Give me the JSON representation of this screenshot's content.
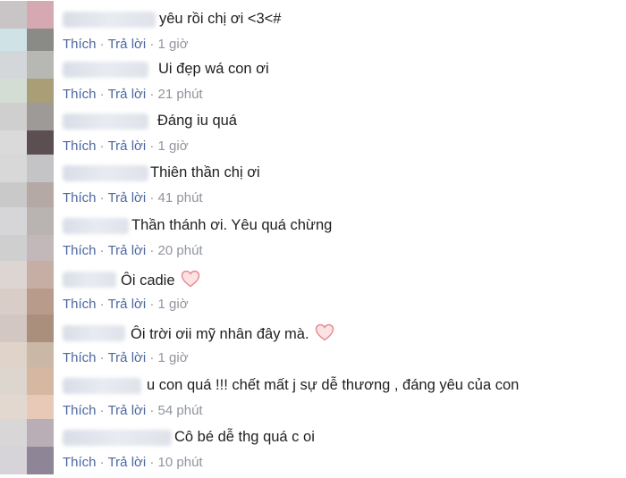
{
  "labels": {
    "like": "Thích",
    "reply": "Trả lời",
    "separator": " · "
  },
  "colors": {
    "link": "#4b67a1",
    "meta": "#90949c",
    "text": "#1c1e21",
    "heart": "#e8888e"
  },
  "comments": [
    {
      "text": "yêu rồi chị ơi <3<#",
      "time": "1 giờ",
      "heart": false
    },
    {
      "text": "Ui đẹp wá con ơi",
      "time": "21 phút",
      "heart": false
    },
    {
      "text": "Đáng iu quá",
      "time": "1 giờ",
      "heart": false
    },
    {
      "text": "Thiên thần chị ơi",
      "time": "41 phút",
      "heart": false
    },
    {
      "text": "Thần thánh ơi. Yêu quá chừng",
      "time": "20 phút",
      "heart": false
    },
    {
      "text": "Ôi cadie",
      "time": "1 giờ",
      "heart": true
    },
    {
      "text": "Ôi trời ơii mỹ nhân đây mà.",
      "time": "1 giờ",
      "heart": true
    },
    {
      "text": "u con quá !!! chết mất j sự dễ thương , đáng yêu của con",
      "time": "54 phút",
      "heart": false
    },
    {
      "text": "Cô bé dễ thg quá c oi",
      "time": "10 phút",
      "heart": false
    }
  ]
}
